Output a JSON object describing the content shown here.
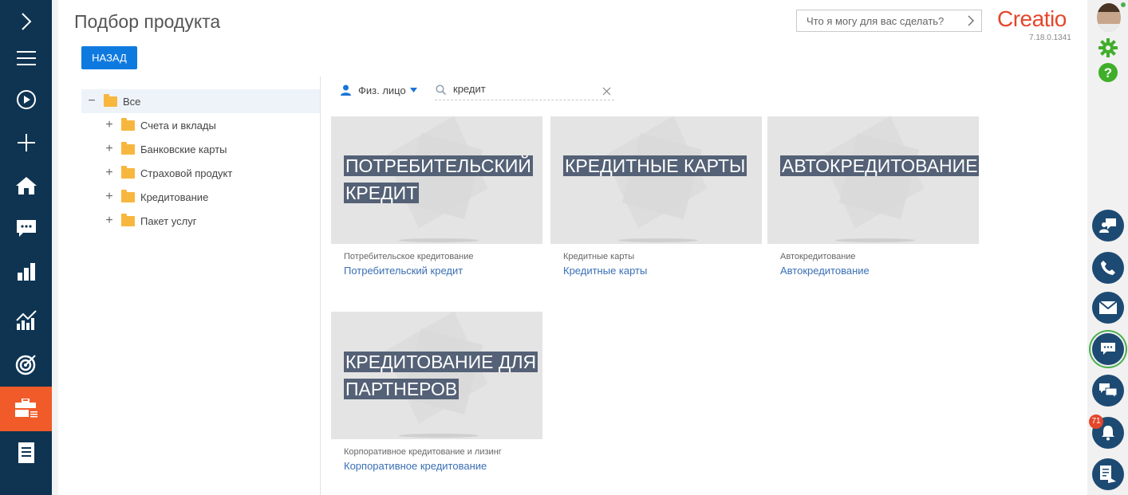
{
  "header": {
    "title": "Подбор продукта",
    "back_label": "НАЗАД",
    "command_placeholder": "Что я могу для вас сделать?",
    "logo": "Creatio",
    "version": "7.18.0.1341"
  },
  "tree": {
    "root": "Все",
    "items": [
      {
        "label": "Счета и вклады"
      },
      {
        "label": "Банковские карты"
      },
      {
        "label": "Страховой продукт"
      },
      {
        "label": "Кредитование"
      },
      {
        "label": "Пакет услуг"
      }
    ]
  },
  "filter": {
    "customer_type": "Физ. лицо",
    "search_value": "кредит"
  },
  "products": [
    {
      "banner_line1": "ПОТРЕБИТЕЛЬСКИЙ",
      "banner_line2": "КРЕДИТ",
      "category": "Потребительское кредитование",
      "name": "Потребительский кредит"
    },
    {
      "banner_line1": "КРЕДИТНЫЕ КАРТЫ ",
      "banner_line2": "",
      "category": "Кредитные карты",
      "name": "Кредитные карты"
    },
    {
      "banner_line1": "АВТОКРЕДИТОВАНИЕ",
      "banner_line2": "",
      "category": "Автокредитование",
      "name": "Автокредитование"
    },
    {
      "banner_line1": "КРЕДИТОВАНИЕ ДЛЯ",
      "banner_line2": "ПАРТНЕРОВ",
      "category": "Корпоративное кредитование и лизинг",
      "name": "Корпоративное кредитование"
    }
  ],
  "notifications": {
    "count": "71"
  },
  "colors": {
    "sidebar": "#0e3452",
    "active": "#f15a29",
    "primary": "#0e7ae0",
    "banner": "#546176",
    "link": "#3a6fb5"
  }
}
